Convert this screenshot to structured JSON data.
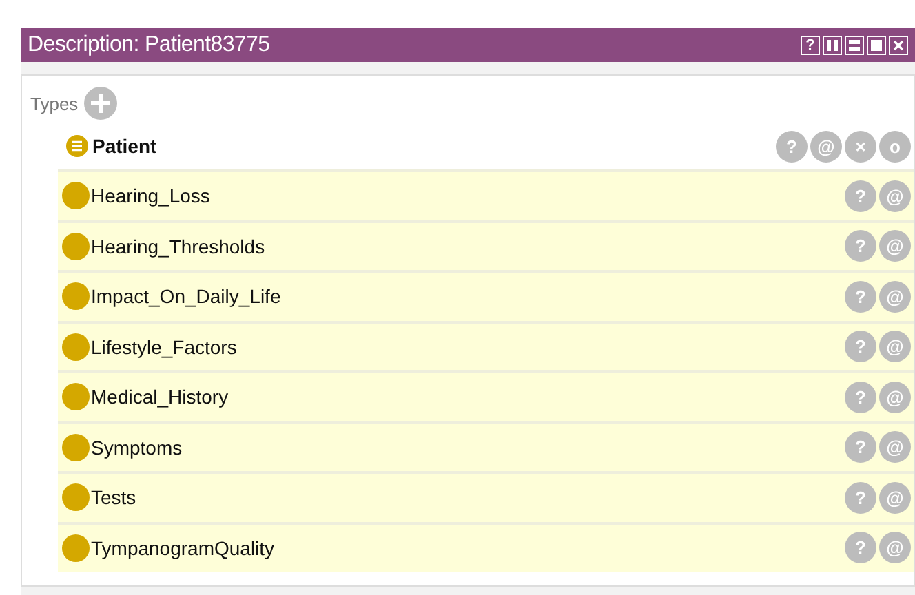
{
  "window": {
    "title": "Description: Patient83775",
    "controls": [
      {
        "kind": "help",
        "label": "?"
      },
      {
        "kind": "columns"
      },
      {
        "kind": "rows"
      },
      {
        "kind": "maximize"
      },
      {
        "kind": "close"
      }
    ]
  },
  "types": {
    "label": "Types",
    "header": {
      "name": "Patient",
      "actions": [
        "?",
        "@",
        "×",
        "o"
      ]
    },
    "items": [
      {
        "name": "Hearing_Loss",
        "actions": [
          "?",
          "@"
        ]
      },
      {
        "name": "Hearing_Thresholds",
        "actions": [
          "?",
          "@"
        ]
      },
      {
        "name": "Impact_On_Daily_Life",
        "actions": [
          "?",
          "@"
        ]
      },
      {
        "name": "Lifestyle_Factors",
        "actions": [
          "?",
          "@"
        ]
      },
      {
        "name": "Medical_History",
        "actions": [
          "?",
          "@"
        ]
      },
      {
        "name": "Symptoms",
        "actions": [
          "?",
          "@"
        ]
      },
      {
        "name": "Tests",
        "actions": [
          "?",
          "@"
        ]
      },
      {
        "name": "TympanogramQuality",
        "actions": [
          "?",
          "@"
        ]
      }
    ]
  }
}
